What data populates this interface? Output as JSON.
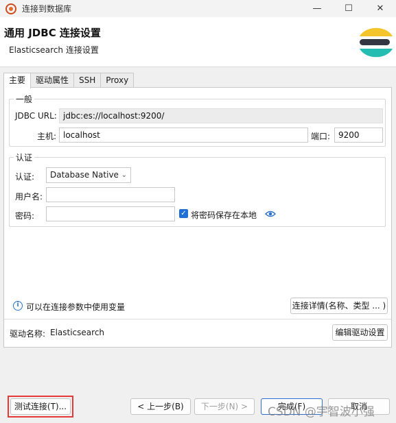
{
  "window": {
    "title": "连接到数据库",
    "min": "—",
    "max": "☐",
    "close": "✕"
  },
  "header": {
    "title": "通用 JDBC 连接设置",
    "subtitle": "Elasticsearch 连接设置"
  },
  "tabs": [
    {
      "label": "主要"
    },
    {
      "label": "驱动属性"
    },
    {
      "label": "SSH"
    },
    {
      "label": "Proxy"
    }
  ],
  "general": {
    "group_label": "一般",
    "jdbc_url_label": "JDBC URL:",
    "jdbc_url_value": "jdbc:es://localhost:9200/",
    "host_label": "主机:",
    "host_value": "localhost",
    "port_label": "端口:",
    "port_value": "9200"
  },
  "auth": {
    "group_label": "认证",
    "auth_label": "认证:",
    "auth_value": "Database Native",
    "username_label": "用户名:",
    "username_value": "",
    "password_label": "密码:",
    "password_value": "",
    "save_password_label": "将密码保存在本地",
    "save_password_checked": true
  },
  "info": {
    "text": "可以在连接参数中使用变量",
    "details_button": "连接详情(名称、类型 ... )"
  },
  "driver": {
    "label": "驱动名称:",
    "value": "Elasticsearch",
    "edit_button": "编辑驱动设置"
  },
  "footer": {
    "test_button": "测试连接(T)...",
    "back_button": "< 上一步(B)",
    "next_button": "下一步(N) >",
    "finish_button": "完成(F)",
    "cancel_button": "取消"
  },
  "watermark": "CSDN @宇智波小强",
  "colors": {
    "accent": "#1f6fd6",
    "highlight": "#e53935",
    "logo_yellow": "#f4c62c",
    "logo_dark": "#343741",
    "logo_teal": "#23bdb1"
  }
}
